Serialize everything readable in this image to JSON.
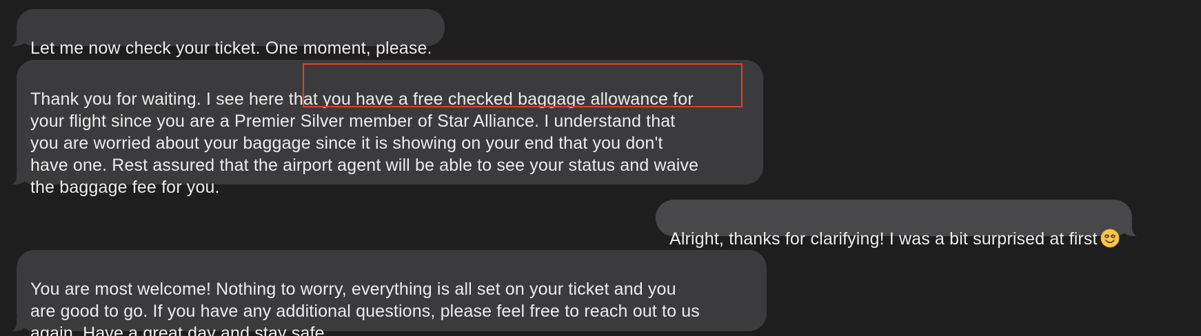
{
  "conversation": {
    "messages": [
      {
        "sender": "agent",
        "text": "Let me now check your ticket. One moment, please."
      },
      {
        "sender": "agent",
        "text": "Thank you for waiting. I see here that you have a free checked baggage allowance for\nyour flight since you are a Premier Silver member of Star Alliance. I understand that\nyou are worried about your baggage since it is showing on your end that you don't\nhave one. Rest assured that the airport agent will be able to see your status and waive\nthe baggage fee for you."
      },
      {
        "sender": "user",
        "text": "Alright, thanks for clarifying! I was a bit surprised at first",
        "emoji": "smiling-face-emoji"
      },
      {
        "sender": "agent",
        "text": "You are most welcome! Nothing to worry, everything is all set on your ticket and you\nare good to go. If you have any additional questions, please feel free to reach out to us\nagain. Have a great day and stay safe."
      }
    ]
  },
  "annotation": {
    "type": "highlight-box",
    "color": "#e0402a"
  },
  "colors": {
    "background": "#1e1e1e",
    "incoming_bubble": "#3b3b3d",
    "outgoing_bubble": "#48484a",
    "text": "#ececec"
  }
}
